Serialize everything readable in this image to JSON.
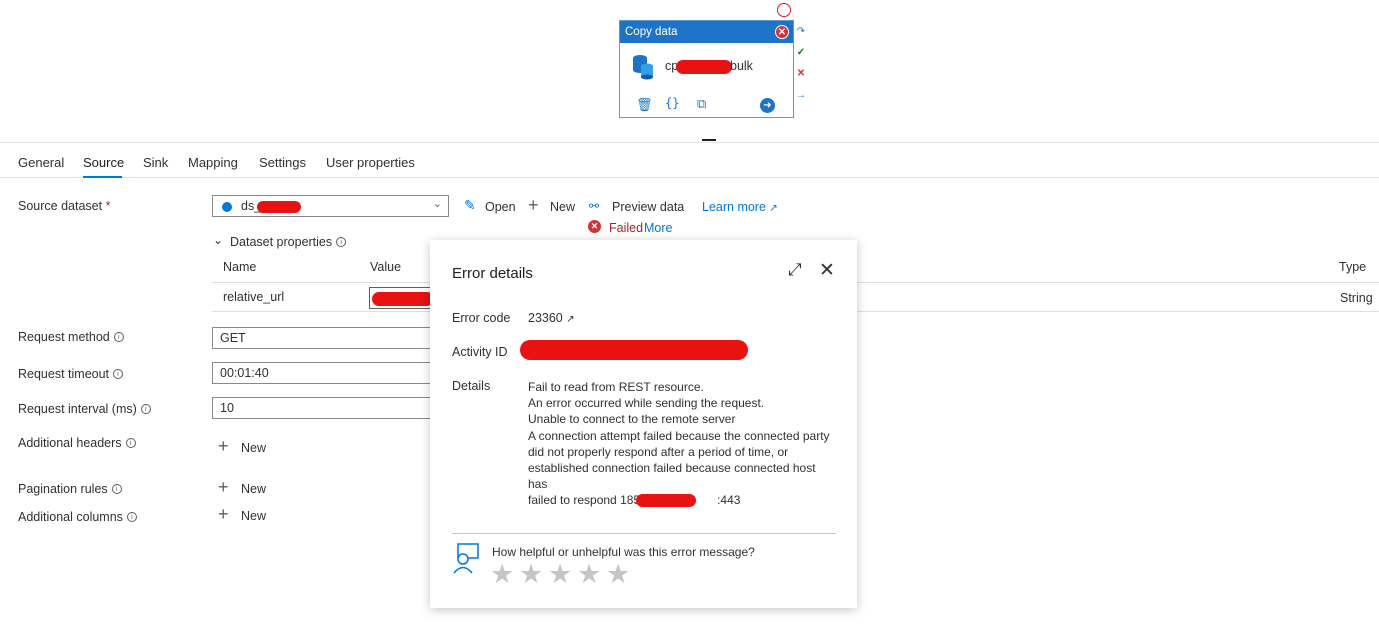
{
  "activity": {
    "type_label": "Copy data",
    "name_prefix": "cp",
    "name_suffix": "bulk",
    "tools": [
      "delete-icon",
      "code-icon",
      "copy-icon",
      "go-icon"
    ],
    "side_icons": [
      "redo-icon",
      "success-icon",
      "fail-icon",
      "completion-icon"
    ]
  },
  "tabs": {
    "general": "General",
    "source": "Source",
    "sink": "Sink",
    "mapping": "Mapping",
    "settings": "Settings",
    "user_properties": "User properties",
    "active": "Source"
  },
  "source": {
    "dataset_label": "Source dataset",
    "required_mark": "*",
    "dataset_value": "ds_",
    "open": "Open",
    "new": "New",
    "preview": "Preview data",
    "learn_more": "Learn more",
    "failed": "Failed",
    "more": "More",
    "dataset_properties": "Dataset properties",
    "table": {
      "col_name": "Name",
      "col_value": "Value",
      "col_type": "Type",
      "row_name": "relative_url",
      "row_type": "String"
    },
    "request_method_label": "Request method",
    "request_method_value": "GET",
    "request_timeout_label": "Request timeout",
    "request_timeout_value": "00:01:40",
    "request_interval_label": "Request interval (ms)",
    "request_interval_value": "10",
    "additional_headers_label": "Additional headers",
    "pagination_rules_label": "Pagination rules",
    "additional_columns_label": "Additional columns",
    "new_label": "New"
  },
  "error": {
    "title": "Error details",
    "code_label": "Error code",
    "code_value": "23360",
    "activity_id_label": "Activity ID",
    "details_label": "Details",
    "details_lines": [
      "Fail to read from REST resource.",
      "An error occurred while sending the request.",
      "Unable to connect to the remote server",
      "A connection attempt failed because the connected party",
      "did not properly respond after a period of time, or",
      "established connection failed because connected host has"
    ],
    "details_last_prefix": "failed to respond 185",
    "details_last_suffix": ":443",
    "feedback_question": "How helpful or unhelpful was this error message?",
    "stars": 5
  },
  "colors": {
    "accent": "#0078d4",
    "activity_header": "#1d74c6",
    "error_red": "#d13438",
    "redaction": "#e81212"
  }
}
